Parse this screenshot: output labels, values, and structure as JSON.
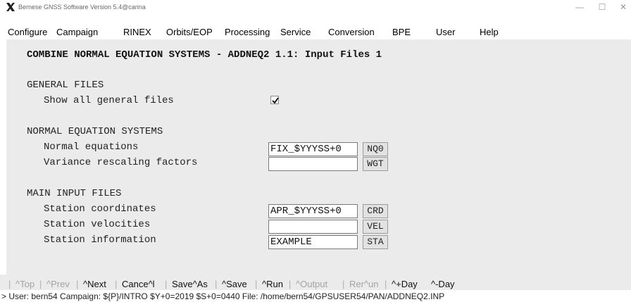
{
  "window": {
    "title": "Bernese GNSS Software Version 5.4@carina",
    "minimize_glyph": "—",
    "maximize_glyph": "☐",
    "close_glyph": "✕"
  },
  "menu": {
    "items": [
      {
        "label": "Configure"
      },
      {
        "label": "Campaign"
      },
      {
        "label": "RINEX"
      },
      {
        "label": "Orbits/EOP"
      },
      {
        "label": "Processing"
      },
      {
        "label": "Service"
      },
      {
        "label": "Conversion"
      },
      {
        "label": "BPE"
      },
      {
        "label": "User"
      },
      {
        "label": "Help"
      }
    ]
  },
  "panel": {
    "heading": "COMBINE NORMAL EQUATION SYSTEMS - ADDNEQ2 1.1: Input Files 1",
    "general": {
      "title": "GENERAL FILES",
      "show_all_label": "Show all general files",
      "show_all_checked": true
    },
    "normal_eq": {
      "title": "NORMAL EQUATION SYSTEMS",
      "normal_equations": {
        "label": "Normal equations",
        "value": "FIX_$YYYSS+0",
        "ext": "NQ0"
      },
      "variance": {
        "label": "Variance rescaling factors",
        "value": "",
        "ext": "WGT"
      }
    },
    "main_input": {
      "title": "MAIN INPUT FILES",
      "coords": {
        "label": "Station coordinates",
        "value": "APR_$YYYSS+0",
        "ext": "CRD"
      },
      "velocities": {
        "label": "Station velocities",
        "value": "",
        "ext": "VEL"
      },
      "info": {
        "label": "Station information",
        "value": "EXAMPLE",
        "ext": "STA"
      }
    }
  },
  "buttons": {
    "top": "^Top",
    "prev": "^Prev",
    "next": "^Next",
    "cancel": "Cance^l",
    "save_as": "Save^As",
    "save": "^Save",
    "run": "^Run",
    "output": "^Output",
    "rerun": "Rer^un",
    "plus_day": "^+Day",
    "minus_day": "^-Day",
    "separator": "|"
  },
  "status": {
    "text": "> User: bern54  Campaign: ${P}/INTRO  $Y+0=2019  $S+0=0440   File: /home/bern54/GPSUSER54/PAN/ADDNEQ2.INP"
  },
  "colors": {
    "panel_bg": "#ebebeb",
    "disabled_text": "#a3a3a3",
    "enabled_text": "#111111",
    "logo_x": "#1f1f1f"
  }
}
